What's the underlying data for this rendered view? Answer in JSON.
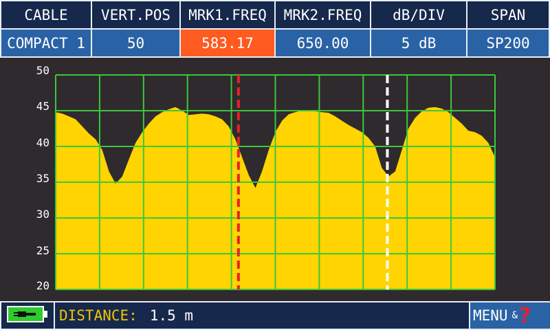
{
  "header": {
    "columns": [
      {
        "label": "CABLE",
        "value": "COMPACT 1"
      },
      {
        "label": "VERT.POS",
        "value": "50"
      },
      {
        "label": "MRK1.FREQ",
        "value": "583.17"
      },
      {
        "label": "MRK2.FREQ",
        "value": "650.00"
      },
      {
        "label": "dB/DIV",
        "value": "5 dB"
      },
      {
        "label": "SPAN",
        "value": "SP200"
      }
    ],
    "active_column": "MRK1.FREQ"
  },
  "status": {
    "label": "DISTANCE:",
    "value": "1.5 m"
  },
  "menu": {
    "label": "MENU",
    "amp": "&",
    "help": "?"
  },
  "colors": {
    "header_bg": "#16284c",
    "value_bg": "#2a62a6",
    "active_value_bg": "#ff5a1f",
    "trace_fill": "#ffd400",
    "grid": "#3cc83c",
    "marker1": "#e8202a",
    "marker2": "#ffffff",
    "battery": "#2ecc2e",
    "status_label": "#f5c400"
  },
  "icons": {
    "battery": "battery-charging-icon"
  },
  "chart_data": {
    "type": "area",
    "ylim": [
      20,
      50
    ],
    "yticks": [
      "50",
      "45",
      "40",
      "35",
      "30",
      "25",
      "20"
    ],
    "x_divisions": 10,
    "grid": true,
    "markers": [
      {
        "name": "MRK1",
        "position_fraction": 0.416,
        "style": "dashed",
        "color": "#e8202a"
      },
      {
        "name": "MRK2",
        "position_fraction": 0.755,
        "style": "dashed",
        "color": "#ffffff"
      }
    ],
    "values": [
      44.8,
      44.6,
      44.2,
      43.8,
      42.8,
      41.8,
      41.0,
      39.5,
      36.5,
      34.8,
      35.8,
      38.2,
      40.5,
      42.0,
      43.2,
      44.2,
      44.8,
      45.2,
      45.5,
      45.0,
      44.4,
      44.5,
      44.6,
      44.5,
      44.2,
      43.8,
      42.8,
      41.0,
      38.5,
      36.0,
      34.2,
      36.5,
      39.5,
      42.0,
      43.6,
      44.5,
      44.8,
      45.0,
      45.0,
      44.9,
      44.8,
      44.7,
      44.2,
      43.6,
      43.0,
      42.5,
      42.0,
      41.2,
      40.0,
      37.0,
      35.8,
      36.5,
      39.5,
      42.5,
      44.0,
      44.9,
      45.4,
      45.5,
      45.3,
      44.8,
      44.0,
      43.2,
      42.2,
      42.0,
      41.5,
      40.5,
      38.5
    ]
  }
}
